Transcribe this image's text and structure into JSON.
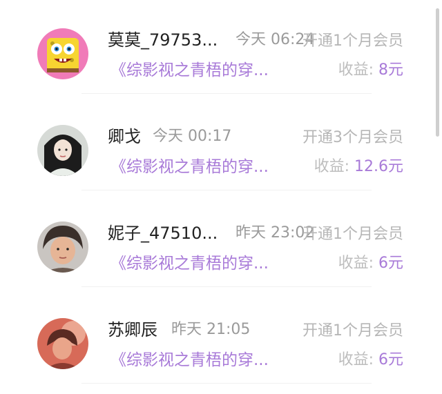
{
  "earnings_list": [
    {
      "name": "莫莫_79753...",
      "time": "今天 06:24",
      "plan": "开通1个月会员",
      "book": "《综影视之青梧的穿...",
      "income_label": "收益:",
      "income_amount": "8元",
      "avatar_icon": "spongebob-avatar-icon"
    },
    {
      "name": "卿戈",
      "time": "今天 00:17",
      "plan": "开通3个月会员",
      "book": "《综影视之青梧的穿...",
      "income_label": "收益:",
      "income_amount": "12.6元",
      "avatar_icon": "user-photo-avatar-icon"
    },
    {
      "name": "妮子_47510...",
      "time": "昨天 23:02",
      "plan": "开通1个月会员",
      "book": "《综影视之青梧的穿...",
      "income_label": "收益:",
      "income_amount": "6元",
      "avatar_icon": "user-photo-avatar-icon"
    },
    {
      "name": "苏卿辰",
      "time": "昨天 21:05",
      "plan": "开通1个月会员",
      "book": "《综影视之青梧的穿...",
      "income_label": "收益:",
      "income_amount": "6元",
      "avatar_icon": "user-photo-avatar-icon"
    }
  ],
  "colors": {
    "accent": "#a87ad8",
    "muted": "#9a9a9a",
    "light_muted": "#b6b6b6"
  }
}
